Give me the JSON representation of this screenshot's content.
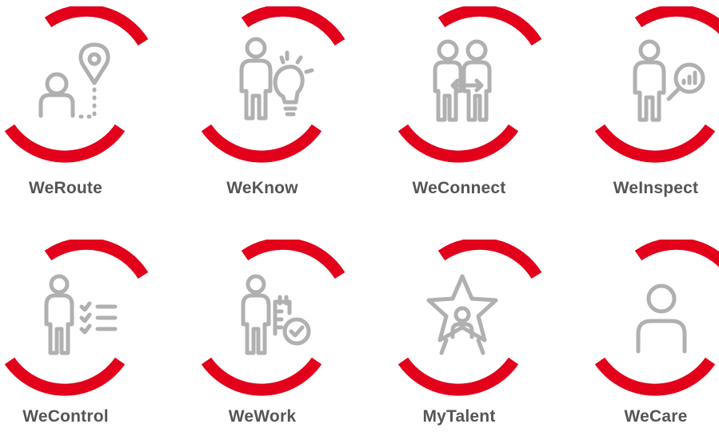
{
  "colors": {
    "accent": "#e2001a",
    "icon": "#b0b0b0",
    "label": "#555555"
  },
  "tiles": [
    {
      "label": "WeRoute",
      "icon": "person-location-pin-icon"
    },
    {
      "label": "WeKnow",
      "icon": "person-lightbulb-icon"
    },
    {
      "label": "WeConnect",
      "icon": "two-persons-arrow-icon"
    },
    {
      "label": "WeInspect",
      "icon": "person-magnifier-chart-icon"
    },
    {
      "label": "WeControl",
      "icon": "person-checklist-icon"
    },
    {
      "label": "WeWork",
      "icon": "person-calendar-check-icon"
    },
    {
      "label": "MyTalent",
      "icon": "person-star-icon"
    },
    {
      "label": "WeCare",
      "icon": "person-icon"
    }
  ]
}
